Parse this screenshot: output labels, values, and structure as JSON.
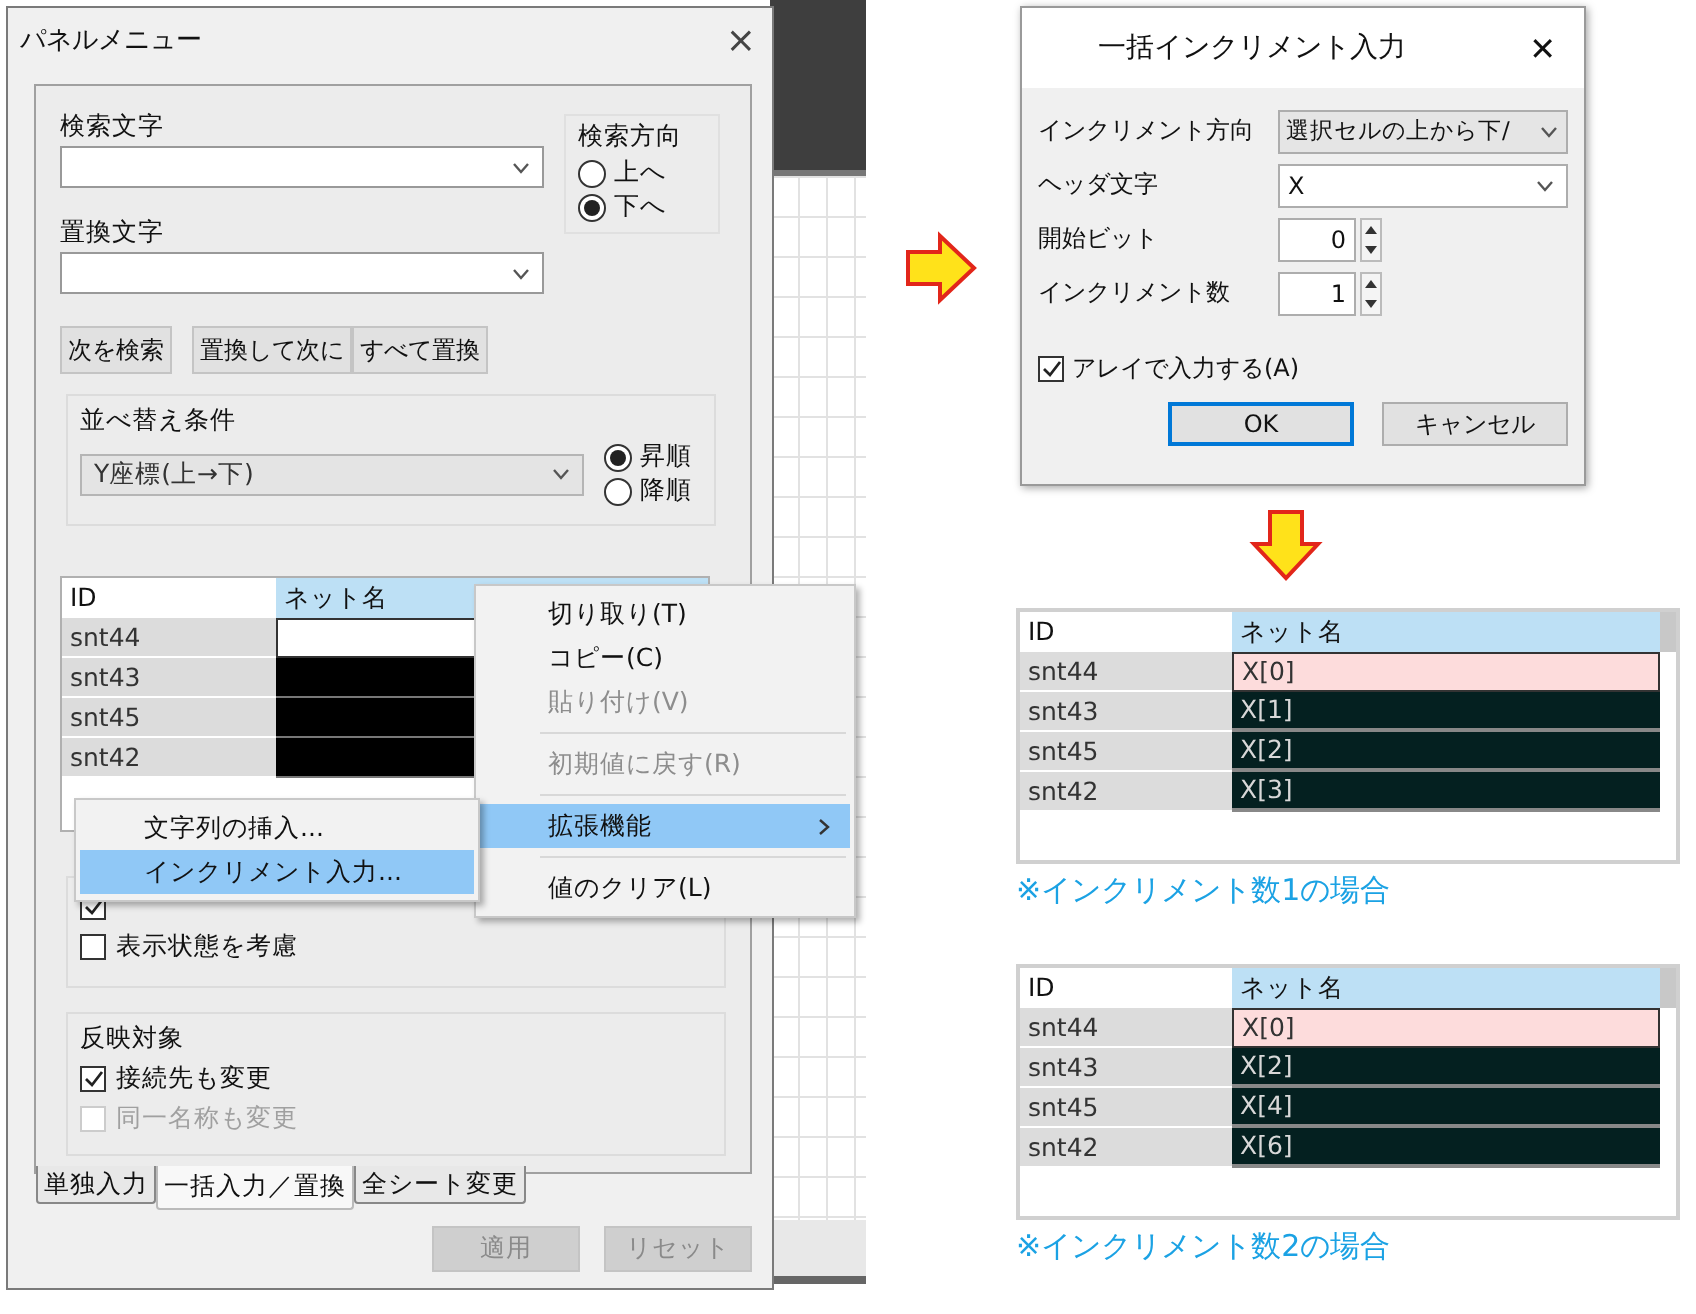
{
  "panel": {
    "title": "パネルメニュー",
    "close": "×",
    "search_label": "検索文字",
    "search_direction": {
      "label": "検索方向",
      "options": [
        {
          "label": "上へ",
          "selected": false
        },
        {
          "label": "下へ",
          "selected": true
        }
      ]
    },
    "replace_label": "置換文字",
    "buttons": [
      "次を検索",
      "置換して次に",
      "すべて置換"
    ],
    "sort": {
      "label": "並べ替え条件",
      "value": "Y座標(上→下)",
      "options": [
        {
          "label": "昇順",
          "selected": true
        },
        {
          "label": "降順",
          "selected": false
        }
      ]
    },
    "table": {
      "columns": [
        "ID",
        "ネット名"
      ],
      "rows": [
        {
          "id": "snt44",
          "kind": "active"
        },
        {
          "id": "snt43",
          "kind": "selected"
        },
        {
          "id": "snt45",
          "kind": "selected"
        },
        {
          "id": "snt42",
          "kind": "selected"
        }
      ]
    },
    "viewer_checkbox": {
      "checked": true
    },
    "display_state": {
      "label": "表示状態を考慮",
      "checked": false
    },
    "reflect": {
      "label": "反映対象",
      "options": [
        {
          "label": "接続先も変更",
          "checked": true,
          "disabled": false
        },
        {
          "label": "同一名称も変更",
          "checked": false,
          "disabled": true
        }
      ]
    },
    "tabs": [
      {
        "label": "単独入力",
        "selected": false
      },
      {
        "label": "一括入力／置換",
        "selected": true
      },
      {
        "label": "全シート変更",
        "selected": false
      }
    ],
    "footer_buttons": [
      {
        "label": "適用",
        "disabled": true
      },
      {
        "label": "リセット",
        "disabled": true
      }
    ]
  },
  "context_menu": {
    "items": [
      {
        "kind": "item",
        "label": "切り取り(T)",
        "disabled": false,
        "selected": false
      },
      {
        "kind": "item",
        "label": "コピー(C)",
        "disabled": false,
        "selected": false
      },
      {
        "kind": "item",
        "label": "貼り付け(V)",
        "disabled": true,
        "selected": false
      },
      {
        "kind": "separator"
      },
      {
        "kind": "item",
        "label": "初期値に戻す(R)",
        "disabled": true,
        "selected": false
      },
      {
        "kind": "separator"
      },
      {
        "kind": "submenu",
        "label": "拡張機能",
        "disabled": false,
        "selected": true
      },
      {
        "kind": "separator"
      },
      {
        "kind": "item",
        "label": "値のクリア(L)",
        "disabled": false,
        "selected": false
      }
    ]
  },
  "submenu": {
    "items": [
      {
        "label": "文字列の挿入...",
        "selected": false
      },
      {
        "label": "インクリメント入力...",
        "selected": true
      }
    ]
  },
  "dialog": {
    "title": "一括インクリメント入力",
    "close": "✕",
    "fields": [
      {
        "kind": "dropdown",
        "label": "インクリメント方向",
        "value": "選択セルの上から下/"
      },
      {
        "kind": "combo",
        "label": "ヘッダ文字",
        "value": "X"
      },
      {
        "kind": "spin",
        "label": "開始ビット",
        "value": "0"
      },
      {
        "kind": "spin",
        "label": "インクリメント数",
        "value": "1"
      }
    ],
    "array_checkbox": {
      "label": "アレイで入力する(A)",
      "checked": true
    },
    "buttons": [
      {
        "label": "OK",
        "default": true
      },
      {
        "label": "キャンセル",
        "default": false
      }
    ]
  },
  "results": [
    {
      "columns": [
        "ID",
        "ネット名"
      ],
      "rows": [
        {
          "id": "snt44",
          "net": "X[0]",
          "kind": "active"
        },
        {
          "id": "snt43",
          "net": "X[1]",
          "kind": "selected"
        },
        {
          "id": "snt45",
          "net": "X[2]",
          "kind": "selected"
        },
        {
          "id": "snt42",
          "net": "X[3]",
          "kind": "selected"
        }
      ],
      "caption": "※インクリメント数1の場合"
    },
    {
      "columns": [
        "ID",
        "ネット名"
      ],
      "rows": [
        {
          "id": "snt44",
          "net": "X[0]",
          "kind": "active"
        },
        {
          "id": "snt43",
          "net": "X[2]",
          "kind": "selected"
        },
        {
          "id": "snt45",
          "net": "X[4]",
          "kind": "selected"
        },
        {
          "id": "snt42",
          "net": "X[6]",
          "kind": "selected"
        }
      ],
      "caption": "※インクリメント数2の場合"
    }
  ]
}
